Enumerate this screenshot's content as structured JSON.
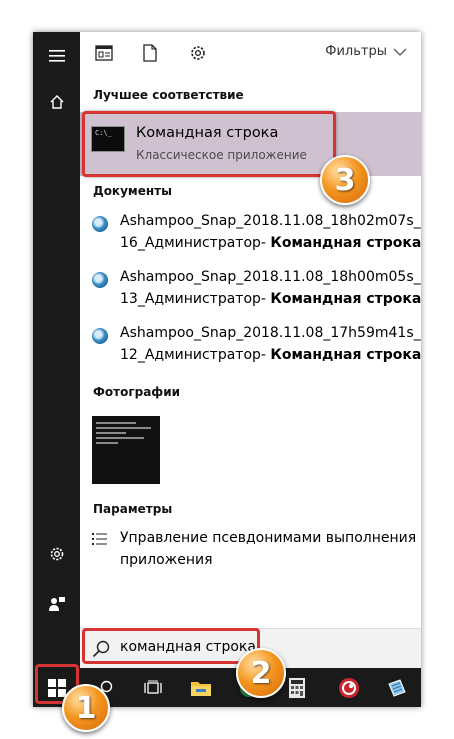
{
  "toolbar": {
    "filters_label": "Фильтры"
  },
  "best_match": {
    "section_label": "Лучшее соответствие",
    "title": "Командная строка",
    "subtitle": "Классическое приложение",
    "icon_text": "C:\\_"
  },
  "documents": {
    "section_label": "Документы",
    "items": [
      {
        "line1": "Ashampoo_Snap_2018.11.08_18h02m07s_0",
        "line2_plain": "16_Администратор- ",
        "line2_bold": "Командная строка"
      },
      {
        "line1": "Ashampoo_Snap_2018.11.08_18h00m05s_0",
        "line2_plain": "13_Администратор- ",
        "line2_bold": "Командная строка"
      },
      {
        "line1": "Ashampoo_Snap_2018.11.08_17h59m41s_0",
        "line2_plain": "12_Администратор- ",
        "line2_bold": "Командная строка"
      }
    ]
  },
  "photos": {
    "section_label": "Фотографии"
  },
  "settings": {
    "section_label": "Параметры",
    "item_line1": "Управление псевдонимами выполнения",
    "item_line2": "приложения"
  },
  "search": {
    "query": "командная строка"
  },
  "annotations": {
    "step1": "1",
    "step2": "2",
    "step3": "3"
  },
  "colors": {
    "accent_highlight": "#cfc1cf",
    "annotation_border": "#d63333",
    "badge": "#f3961f",
    "taskbar": "#1a1a1a"
  }
}
